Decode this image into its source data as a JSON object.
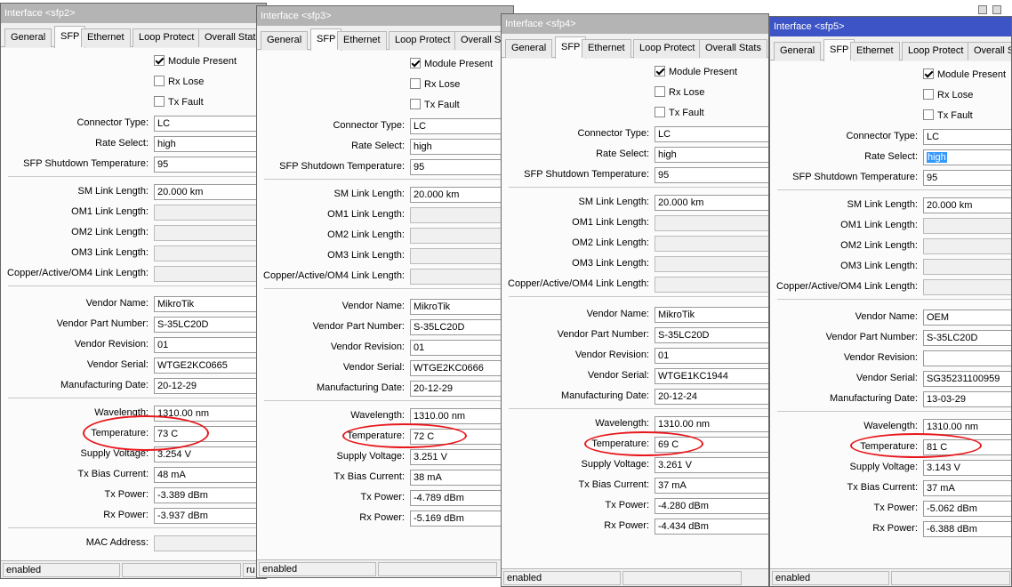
{
  "labels": {
    "module_present": "Module Present",
    "rx_lose": "Rx Lose",
    "tx_fault": "Tx Fault",
    "connector_type": "Connector Type:",
    "rate_select": "Rate Select:",
    "sfp_shutdown_temp": "SFP Shutdown Temperature:",
    "sm_link_length": "SM Link Length:",
    "om1_link_length": "OM1 Link Length:",
    "om2_link_length": "OM2 Link Length:",
    "om3_link_length": "OM3 Link Length:",
    "copper_link_length": "Copper/Active/OM4 Link Length:",
    "vendor_name": "Vendor Name:",
    "vendor_part_number": "Vendor Part Number:",
    "vendor_revision": "Vendor Revision:",
    "vendor_serial": "Vendor Serial:",
    "manufacturing_date": "Manufacturing Date:",
    "wavelength": "Wavelength:",
    "temperature": "Temperature:",
    "supply_voltage": "Supply Voltage:",
    "tx_bias_current": "Tx Bias Current:",
    "tx_power": "Tx Power:",
    "rx_power": "Rx Power:",
    "mac_address": "MAC Address:"
  },
  "tabs": [
    "General",
    "SFP",
    "Ethernet",
    "Loop Protect",
    "Overall Stats"
  ],
  "colors": {
    "title_active": "#3d54c6",
    "title_inactive": "#b4b4b4",
    "annotation": "#e8171c",
    "selection": "#3399ff"
  },
  "windows": [
    {
      "title": "Interface <sfp2>",
      "module_present": true,
      "rx_lose": false,
      "tx_fault": false,
      "connector_type": "LC",
      "rate_select": "high",
      "sfp_shutdown_temp": "95",
      "sm_link_length": "20.000 km",
      "vendor_name": "MikroTik",
      "vendor_part_number": "S-35LC20D",
      "vendor_revision": "01",
      "vendor_serial": "WTGE2KC0665",
      "manufacturing_date": "20-12-29",
      "wavelength": "1310.00 nm",
      "temperature": "73 C",
      "supply_voltage": "3.254 V",
      "tx_bias_current": "48 mA",
      "tx_power": "-3.389 dBm",
      "rx_power": "-3.937 dBm",
      "status": "enabled",
      "status_right": "ru"
    },
    {
      "title": "Interface <sfp3>",
      "module_present": true,
      "rx_lose": false,
      "tx_fault": false,
      "connector_type": "LC",
      "rate_select": "high",
      "sfp_shutdown_temp": "95",
      "sm_link_length": "20.000 km",
      "vendor_name": "MikroTik",
      "vendor_part_number": "S-35LC20D",
      "vendor_revision": "01",
      "vendor_serial": "WTGE2KC0666",
      "manufacturing_date": "20-12-29",
      "wavelength": "1310.00 nm",
      "temperature": "72 C",
      "supply_voltage": "3.251 V",
      "tx_bias_current": "38 mA",
      "tx_power": "-4.789 dBm",
      "rx_power": "-5.169 dBm",
      "status": "enabled"
    },
    {
      "title": "Interface <sfp4>",
      "module_present": true,
      "rx_lose": false,
      "tx_fault": false,
      "connector_type": "LC",
      "rate_select": "high",
      "sfp_shutdown_temp": "95",
      "sm_link_length": "20.000 km",
      "vendor_name": "MikroTik",
      "vendor_part_number": "S-35LC20D",
      "vendor_revision": "01",
      "vendor_serial": "WTGE1KC1944",
      "manufacturing_date": "20-12-24",
      "wavelength": "1310.00 nm",
      "temperature": "69 C",
      "supply_voltage": "3.261 V",
      "tx_bias_current": "37 mA",
      "tx_power": "-4.280 dBm",
      "rx_power": "-4.434 dBm",
      "status": "enabled"
    },
    {
      "title": "Interface <sfp5>",
      "module_present": true,
      "rx_lose": false,
      "tx_fault": false,
      "connector_type": "LC",
      "rate_select": "high",
      "sfp_shutdown_temp": "95",
      "sm_link_length": "20.000 km",
      "vendor_name": "OEM",
      "vendor_part_number": "S-35LC20D",
      "vendor_revision": "",
      "vendor_serial": "SG35231100959",
      "manufacturing_date": "13-03-29",
      "wavelength": "1310.00 nm",
      "temperature": "81 C",
      "supply_voltage": "3.143 V",
      "tx_bias_current": "37 mA",
      "tx_power": "-5.062 dBm",
      "rx_power": "-6.388 dBm",
      "status": "enabled"
    }
  ]
}
